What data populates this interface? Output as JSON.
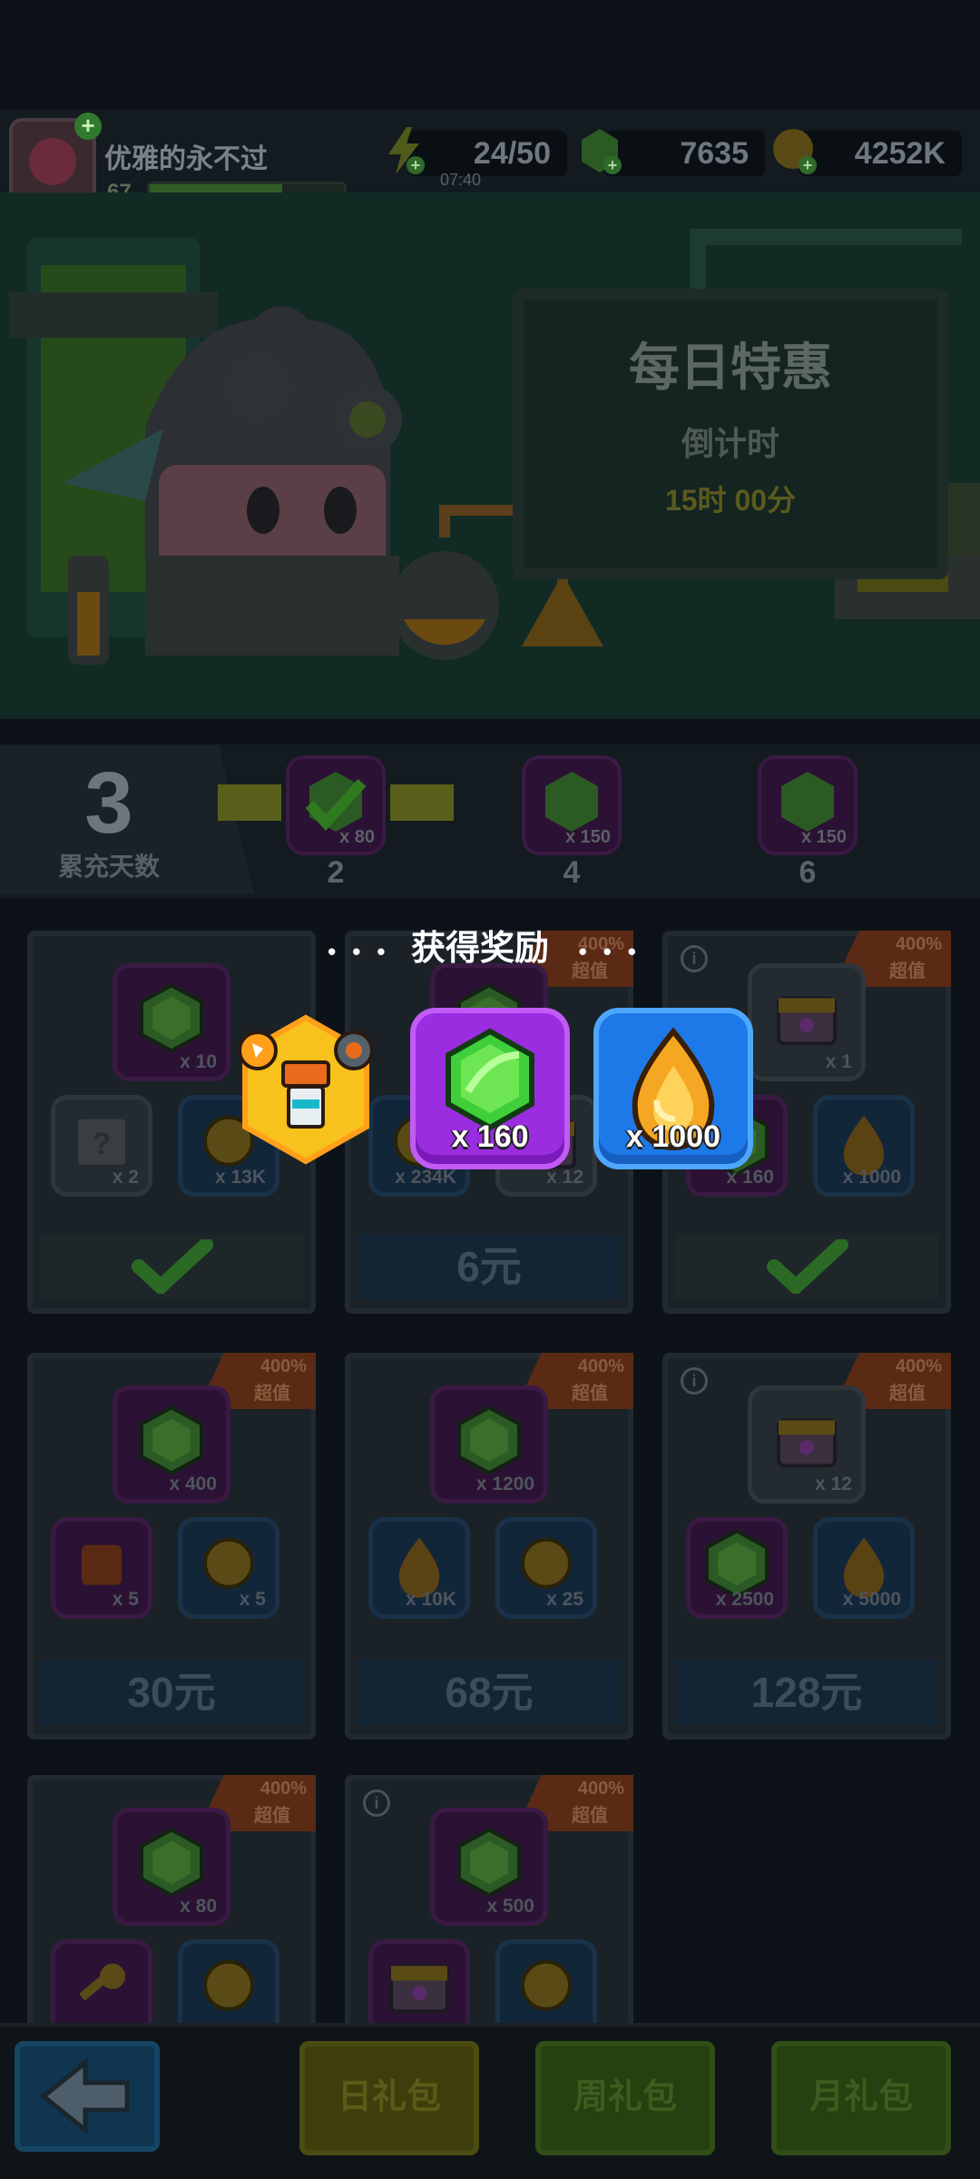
{
  "player": {
    "name": "优雅的永不过",
    "level": "67",
    "xp_progress": 0.68
  },
  "resources": {
    "energy": "24/50",
    "energy_timer": "07:40",
    "gems": "7635",
    "coins": "4252K"
  },
  "daily_offer": {
    "title": "每日特惠",
    "subtitle": "倒计时",
    "countdown": "15时 00分"
  },
  "streak": {
    "days": "3",
    "label": "累充天数",
    "milestones": [
      {
        "day": "2",
        "amount": "x 80",
        "claimed": true
      },
      {
        "day": "4",
        "amount": "x 150",
        "claimed": false
      },
      {
        "day": "6",
        "amount": "x 150",
        "claimed": false
      }
    ]
  },
  "popup": {
    "title": "获得奖励",
    "rewards": [
      {
        "icon": "badge-hex-icon",
        "quantity": ""
      },
      {
        "icon": "gem-icon",
        "quantity": "x 160"
      },
      {
        "icon": "fire-drop-icon",
        "quantity": "x 1000"
      }
    ]
  },
  "cards": [
    {
      "ribbon": "",
      "main": "x 10",
      "items": [
        "x 2",
        "x 13K"
      ],
      "price": "",
      "claimed": true
    },
    {
      "ribbon": "400%|超值",
      "main": "",
      "items": [
        "x 234K",
        "x 12"
      ],
      "price": "6元",
      "claimed": false
    },
    {
      "ribbon": "400%|超值",
      "main": "x 1",
      "items": [
        "x 160",
        "x 1000"
      ],
      "price": "",
      "claimed": true
    },
    {
      "ribbon": "400%|超值",
      "main": "x 400",
      "items": [
        "x 5",
        "x 5"
      ],
      "price": "30元",
      "claimed": false
    },
    {
      "ribbon": "400%|超值",
      "main": "x 1200",
      "items": [
        "x 10K",
        "x 25"
      ],
      "price": "68元",
      "claimed": false
    },
    {
      "ribbon": "400%|超值",
      "main": "x 12",
      "items": [
        "x 2500",
        "x 5000"
      ],
      "price": "128元",
      "claimed": false
    },
    {
      "ribbon": "400%|超值",
      "main": "x 80",
      "items": [
        "",
        ""
      ],
      "price": "",
      "claimed": false
    },
    {
      "ribbon": "400%|超值",
      "main": "x 500",
      "items": [
        "",
        ""
      ],
      "price": "",
      "claimed": false
    }
  ],
  "ribbon_text": {
    "pct": "400%",
    "label": "超值"
  },
  "nav": {
    "daily": "日礼包",
    "weekly": "周礼包",
    "monthly": "月礼包"
  },
  "colors": {
    "gem": "#3fcf3a",
    "fire": "#f5a623",
    "badge": "#f6c21b"
  }
}
